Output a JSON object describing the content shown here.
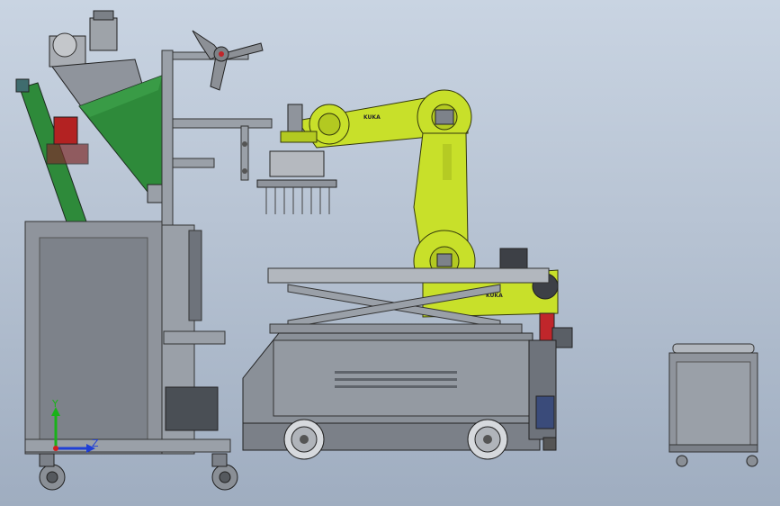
{
  "viewport": {
    "background_top": "#c9d4e2",
    "background_bottom": "#9fadc0"
  },
  "robot": {
    "brand_upper": "KUKA",
    "brand_lower": "KUKA",
    "color": "#c8e02a"
  },
  "triad": {
    "y_label": "Y",
    "z_label": "Z",
    "y_color": "#19b219",
    "z_color": "#1f3fd6",
    "x_color": "#d21f1f"
  },
  "colors": {
    "hopper": "#2e8a3a",
    "cabinet": "#8f949c",
    "cabinet_dark": "#6e737b",
    "frame": "#9aa0a8"
  }
}
